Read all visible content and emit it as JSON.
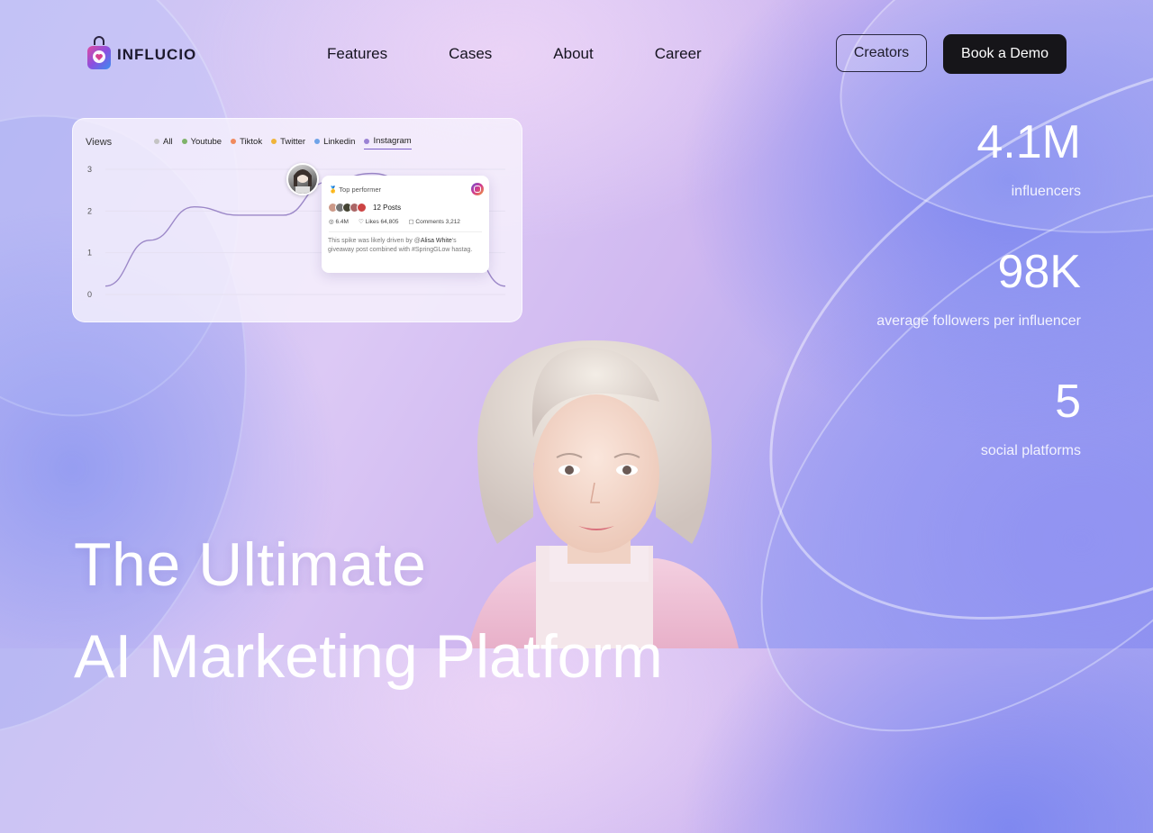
{
  "brand": {
    "name": "INFLUCIO"
  },
  "nav": {
    "items": [
      "Features",
      "Cases",
      "About",
      "Career"
    ]
  },
  "header": {
    "creators_label": "Creators",
    "demo_label": "Book a Demo"
  },
  "chart_card": {
    "views_label": "Views",
    "legend": [
      {
        "label": "All",
        "color": "#c4c4c4"
      },
      {
        "label": "Youtube",
        "color": "#7fb36a"
      },
      {
        "label": "Tiktok",
        "color": "#f08a5d"
      },
      {
        "label": "Twitter",
        "color": "#f0b43a"
      },
      {
        "label": "Linkedin",
        "color": "#6fa3e8"
      },
      {
        "label": "Instagram",
        "color": "#9b82d4",
        "active": true
      }
    ],
    "tooltip": {
      "header": "Top performer",
      "posts": "12 Posts",
      "views": "6.4M",
      "likes": "Likes 64,805",
      "comments": "Comments 3,212",
      "note_prefix": "This spike was likely driven by @",
      "note_user": "Alisa White",
      "note_suffix": "'s giveaway post combined with #SpringGLow hastag."
    }
  },
  "chart_data": {
    "type": "line",
    "title": "",
    "ylabel": "Views",
    "ylim": [
      0,
      3
    ],
    "yticks": [
      0,
      1,
      2,
      3
    ],
    "series": [
      {
        "name": "Instagram",
        "x": [
          0,
          1,
          2,
          3,
          4,
          5,
          6,
          7,
          8,
          9
        ],
        "values": [
          0.2,
          1.3,
          2.1,
          1.9,
          1.9,
          2.7,
          2.9,
          2.6,
          1.4,
          0.2
        ]
      }
    ]
  },
  "stats": [
    {
      "value": "4.1M",
      "label": "influencers"
    },
    {
      "value": "98K",
      "label": "average followers per influencer"
    },
    {
      "value": "5",
      "label": "social platforms"
    }
  ],
  "hero": {
    "line1": "The Ultimate",
    "line2": "AI Marketing Platform"
  }
}
